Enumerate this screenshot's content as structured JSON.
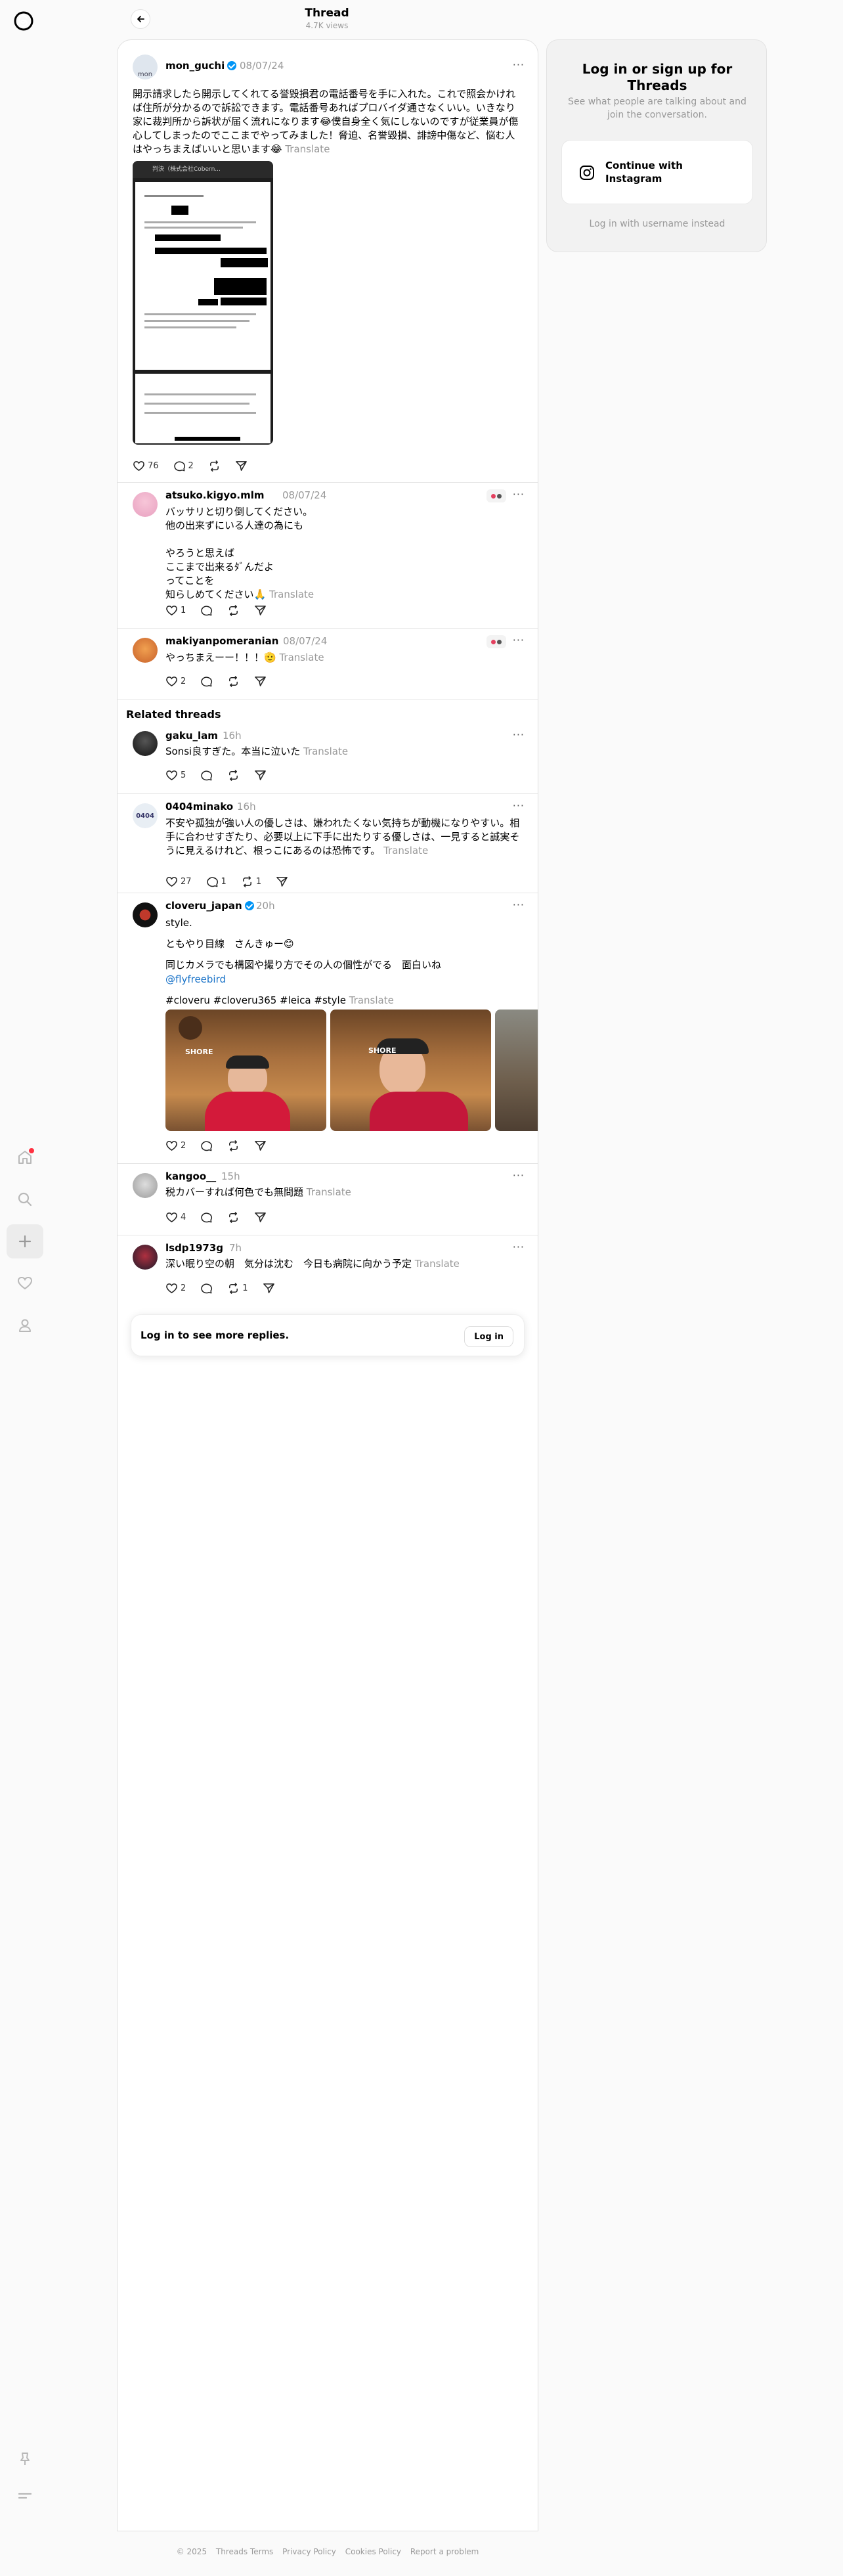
{
  "header": {
    "title": "Thread",
    "views": "4.7K views"
  },
  "nav": {
    "items": [
      "home-icon",
      "search-icon",
      "create-icon",
      "heart-icon",
      "profile-icon"
    ],
    "bottom": [
      "pin-icon",
      "menu-icon"
    ]
  },
  "main_post": {
    "username": "mon_guchi",
    "avatar_alt": "mon",
    "date": "08/07/24",
    "text": "開示請求したら開示してくれてる誉毀損君の電話番号を手に入れた。これで照会かければ住所が分かるので訴訟できます。電話番号あればプロバイダ通さなくいい。いきなり家に裁判所から訴状が届く流れになります😂僕自身全く気にしないのですが従業員が傷心してしまったのでここまでやってみました！脅迫、名誉毀損、誹謗中傷など、悩む人はやっちまえばいいと思います😂",
    "translate": "Translate",
    "likes": "76",
    "replies": "2",
    "attachment_title": "判決（株式会社Cobern..."
  },
  "replies": [
    {
      "username": "atsuko.kigyo.mlm",
      "date": "08/07/24",
      "lines": [
        "バッサリと切り倒してください。",
        "他の出来ずにいる人達の為にも",
        "",
        "やろうと思えば",
        "ここまで出来るﾀﾞんだよ",
        "ってことを",
        "知らしめてください🙏"
      ],
      "translate": "Translate",
      "likes": "1"
    },
    {
      "username": "makiyanpomeranian",
      "date": "08/07/24",
      "text": "やっちまえーー！！！🫡",
      "translate": "Translate",
      "likes": "2"
    }
  ],
  "related_title": "Related threads",
  "related": [
    {
      "username": "gaku_lam",
      "date": "16h",
      "text": "Sonsi良すぎた。本当に泣いた",
      "translate": "Translate",
      "likes": "5"
    },
    {
      "username": "0404minako",
      "avatar_alt": "0404",
      "date": "16h",
      "text": "不安や孤独が強い人の優しさは、嫌われたくない気持ちが動機になりやすい。相手に合わせすぎたり、必要以上に下手に出たりする優しさは、一見すると誠実そうに見えるけれど、根っこにあるのは恐怖です。",
      "translate": "Translate",
      "likes": "27",
      "replies": "1",
      "reposts": "1"
    },
    {
      "username": "cloveru_japan",
      "date": "20h",
      "lines": [
        "style.",
        "",
        "ともやり目線　さんきゅー😊",
        "",
        "同じカメラでも構図や撮り方でその人の個性がでる　面白いね"
      ],
      "mention": "@flyfreebird",
      "tags": "#cloveru #cloveru365 #leica #style",
      "translate": "Translate",
      "likes": "2",
      "photo_label": "SHORE"
    },
    {
      "username": "kangoo__",
      "date": "15h",
      "text": "税カバーすれば何色でも無問題",
      "translate": "Translate",
      "likes": "4"
    },
    {
      "username": "lsdp1973g",
      "date": "7h",
      "text": "深い眠り空の朝　気分は沈む　今日も病院に向かう予定",
      "translate": "Translate",
      "likes": "2",
      "reposts": "1"
    }
  ],
  "login_prompt": {
    "text": "Log in to see more replies.",
    "button": "Log in"
  },
  "side": {
    "title": "Log in or sign up for Threads",
    "subtitle": "See what people are talking about and join the conversation.",
    "instagram_button": "Continue with Instagram",
    "username_link": "Log in with username instead"
  },
  "footer": [
    "© 2025",
    "Threads Terms",
    "Privacy Policy",
    "Cookies Policy",
    "Report a problem"
  ],
  "colors": {
    "verified": "#0095f6",
    "notification": "#ff3040",
    "mention": "#1a73c8"
  }
}
